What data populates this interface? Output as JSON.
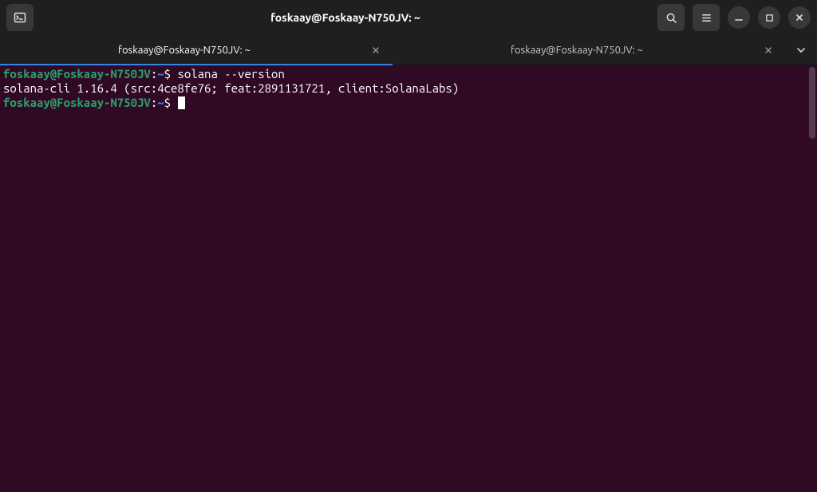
{
  "window": {
    "title": "foskaay@Foskaay-N750JV: ~"
  },
  "tabs": [
    {
      "title": "foskaay@Foskaay-N750JV: ~",
      "active": true
    },
    {
      "title": "foskaay@Foskaay-N750JV: ~",
      "active": false
    }
  ],
  "prompt": {
    "user_host": "foskaay@Foskaay-N750JV",
    "separator": ":",
    "path": "~",
    "symbol": "$"
  },
  "terminal": {
    "lines": [
      {
        "type": "prompt",
        "command": "solana --version"
      },
      {
        "type": "output",
        "text": "solana-cli 1.16.4 (src:4ce8fe76; feat:2891131721, client:SolanaLabs)"
      },
      {
        "type": "prompt",
        "command": "",
        "cursor": true
      }
    ]
  },
  "colors": {
    "terminal_bg": "#300a24",
    "prompt_user": "#26a269",
    "prompt_path": "#2a7bde",
    "text": "#ffffff"
  }
}
